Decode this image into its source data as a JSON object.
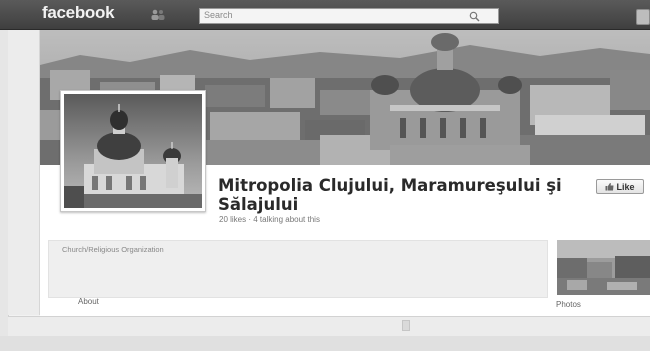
{
  "topbar": {
    "logo": "facebook",
    "search_placeholder": "Search",
    "icons": [
      "friends-notification-icon",
      "search-icon",
      "profile-avatar"
    ]
  },
  "page": {
    "name": "Mitropolia Clujului, Maramureşului şi Sălajului",
    "stats": "20 likes · 4 talking about this",
    "like_label": "Like",
    "category": "Church/Religious Organization",
    "about_label": "About",
    "photos_label": "Photos"
  },
  "colors": {
    "topbar": "#4a4a4a",
    "content_bg": "#ffffff",
    "about_box": "#efefef"
  }
}
